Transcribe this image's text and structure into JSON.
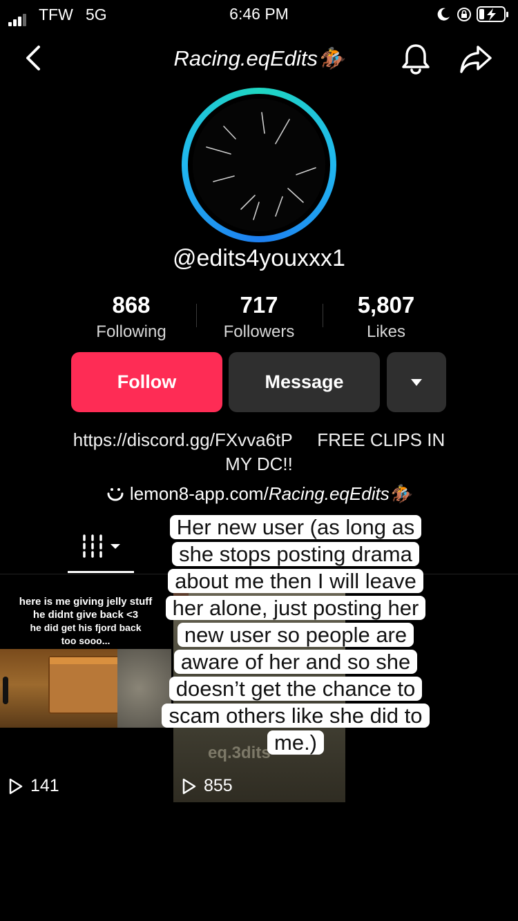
{
  "status_bar": {
    "carrier": "TFW",
    "network": "5G",
    "time": "6:46 PM"
  },
  "header": {
    "title": "Racing.eqEdits🏇"
  },
  "profile": {
    "username": "@edits4youxxx1"
  },
  "stats": [
    {
      "value": "868",
      "label": "Following"
    },
    {
      "value": "717",
      "label": "Followers"
    },
    {
      "value": "5,807",
      "label": "Likes"
    }
  ],
  "actions": {
    "follow": "Follow",
    "message": "Message"
  },
  "bio": {
    "line1": "https://discord.gg/FXvva6tP     FREE CLIPS IN",
    "line2": "MY DC!!"
  },
  "link": {
    "domain": "lemon8-app.com/",
    "handle": "Racing.eqEdits🏇"
  },
  "videos": [
    {
      "caption": [
        "here is me giving jelly stuff",
        "he didnt give back <3",
        "he did get his fjord back",
        "too sooo..."
      ],
      "views": "141"
    },
    {
      "watermark": "eq.3dits",
      "views": "855"
    }
  ],
  "overlay_text": "Her new user (as long as she stops posting drama about me then I will leave her alone, just posting her new user so people are aware of her and so she doesn’t get the chance to scam others like she did to me.)",
  "colors": {
    "follow": "#fe2c55",
    "secondary_button": "#2f2f2f",
    "ring_start": "#1fd6c1",
    "ring_end": "#1e7ff0"
  }
}
